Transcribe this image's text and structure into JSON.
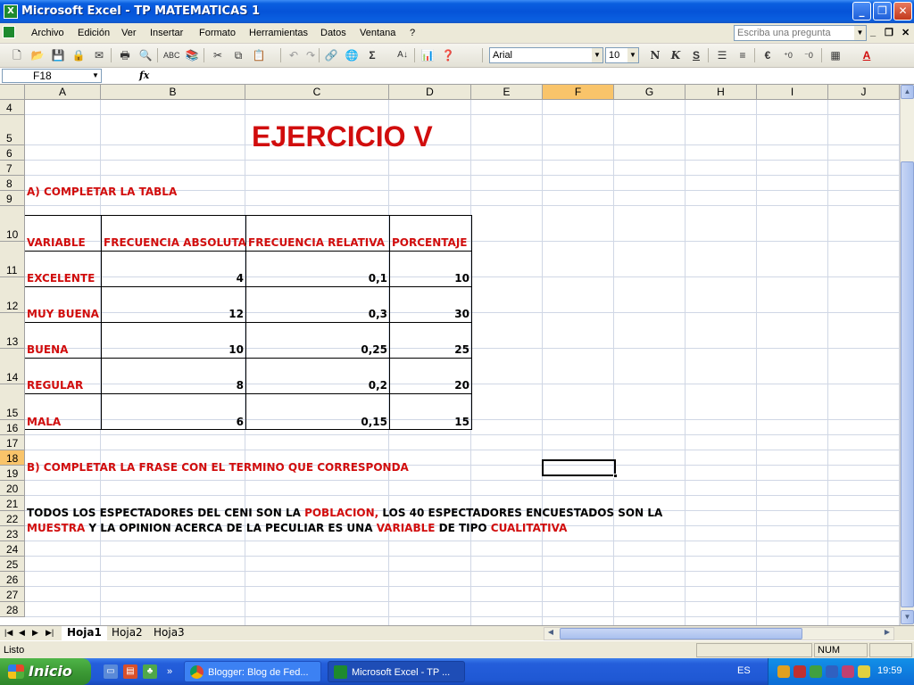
{
  "window": {
    "title": "Microsoft Excel - TP MATEMATICAS 1",
    "app_icon": "X"
  },
  "menu": {
    "items": [
      "Archivo",
      "Edición",
      "Ver",
      "Insertar",
      "Formato",
      "Herramientas",
      "Datos",
      "Ventana",
      "?"
    ],
    "help_placeholder": "Escriba una pregunta"
  },
  "toolbar": {
    "font_name": "Arial",
    "font_size": "10",
    "bold": "N",
    "italic": "K",
    "underline": "S",
    "sum": "Σ"
  },
  "formula_bar": {
    "name_box": "F18",
    "fx_label": "fx",
    "content": ""
  },
  "columns": [
    "A",
    "B",
    "C",
    "D",
    "E",
    "F",
    "G",
    "H",
    "I",
    "J"
  ],
  "rows": [
    "4",
    "5",
    "6",
    "7",
    "8",
    "9",
    "10",
    "11",
    "12",
    "13",
    "14",
    "15",
    "16",
    "17",
    "18",
    "19",
    "20",
    "21",
    "22",
    "23",
    "24",
    "25",
    "26",
    "27",
    "28"
  ],
  "sheet": {
    "heading": "EJERCICIO V",
    "section_a": "A) COMPLETAR LA TABLA",
    "table": {
      "headers": [
        "VARIABLE",
        "FRECUENCIA ABSOLUTA",
        "FRECUENCIA RELATIVA",
        "PORCENTAJE"
      ],
      "rows": [
        [
          "EXCELENTE",
          "4",
          "0,1",
          "10"
        ],
        [
          "MUY BUENA",
          "12",
          "0,3",
          "30"
        ],
        [
          "BUENA",
          "10",
          "0,25",
          "25"
        ],
        [
          "REGULAR",
          "8",
          "0,2",
          "20"
        ],
        [
          "MALA",
          "6",
          "0,15",
          "15"
        ]
      ]
    },
    "section_b": "B) COMPLETAR LA FRASE CON EL TERMINO QUE CORRESPONDA",
    "line21": {
      "p1": "TODOS LOS ESPECTADORES DEL CENI SON LA ",
      "w1": "POBLACION,",
      "p2": " LOS 40 ESPECTADORES ENCUESTADOS SON LA"
    },
    "line22": {
      "w1": "MUESTRA",
      "p1": " Y LA OPINION ACERCA DE LA PECULIAR ES UNA ",
      "w2": "VARIABLE",
      "p2": " DE TIPO ",
      "w3": "CUALITATIVA"
    }
  },
  "tabs": [
    "Hoja1",
    "Hoja2",
    "Hoja3"
  ],
  "status": {
    "text": "Listo",
    "num": "NUM"
  },
  "taskbar": {
    "start": "Inicio",
    "tasks": [
      "Blogger: Blog de Fed...",
      "Microsoft Excel - TP ..."
    ],
    "language": "ES",
    "clock": "19:59"
  },
  "colors": {
    "accent_red": "#D10D0D",
    "selected_header": "#F9C46A",
    "xp_blue": "#0553D8"
  }
}
